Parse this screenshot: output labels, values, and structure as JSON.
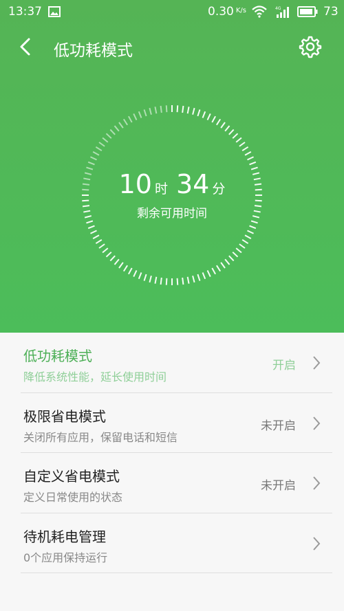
{
  "status_bar": {
    "time": "13:37",
    "net_speed": "0.30",
    "net_speed_unit": "K/s",
    "battery_pct": "73",
    "icons": [
      "gallery-icon",
      "wifi-icon",
      "4g-signal-icon",
      "battery-icon"
    ]
  },
  "app_bar": {
    "title": "低功耗模式",
    "back_icon": "back-arrow-icon",
    "settings_icon": "gear-icon"
  },
  "dial": {
    "hours": "10",
    "hours_unit": "时",
    "minutes": "34",
    "minutes_unit": "分",
    "label": "剩余可用时间"
  },
  "modes": [
    {
      "title": "低功耗模式",
      "subtitle": "降低系统性能，延长使用时间",
      "state": "开启",
      "active": true
    },
    {
      "title": "极限省电模式",
      "subtitle": "关闭所有应用，保留电话和短信",
      "state": "未开启",
      "active": false
    },
    {
      "title": "自定义省电模式",
      "subtitle": "定义日常使用的状态",
      "state": "未开启",
      "active": false
    },
    {
      "title": "待机耗电管理",
      "subtitle": "0个应用保持运行",
      "state": "",
      "active": false
    }
  ],
  "colors": {
    "accent": "#4caf56",
    "header_bg": "#55b455",
    "list_bg": "#f7f7f7"
  }
}
